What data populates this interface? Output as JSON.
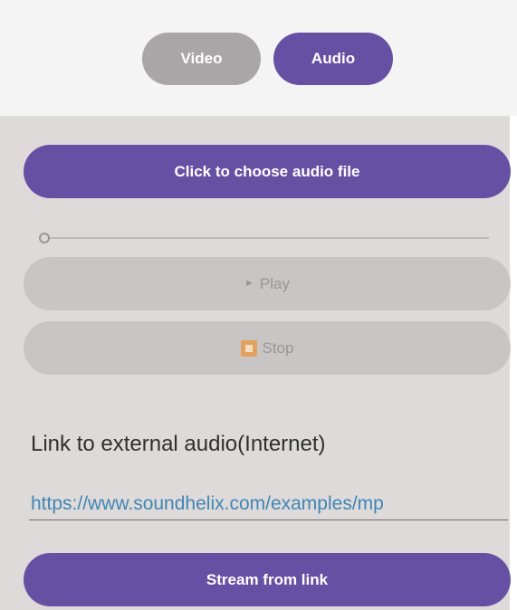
{
  "mode_toggle": {
    "video_label": "Video",
    "audio_label": "Audio",
    "selected": "Audio"
  },
  "file_picker": {
    "label": "Click to choose audio file"
  },
  "seek_bar": {
    "progress": 0
  },
  "controls": {
    "play_label": "Play",
    "stop_label": "Stop",
    "play_icon": "play-triangle-icon",
    "stop_icon": "stop-square-icon"
  },
  "external_link": {
    "heading": "Link to external audio(Internet)",
    "url_value": "https://www.soundhelix.com/examples/mp",
    "stream_label": "Stream from link"
  },
  "colors": {
    "accent": "#6650a4",
    "inactive_toggle": "#a8a6a7",
    "panel_bg": "#dedad9",
    "disabled_button": "#c9c5c5",
    "link_text": "#3f86b5",
    "stop_icon": "#e3a15f"
  }
}
